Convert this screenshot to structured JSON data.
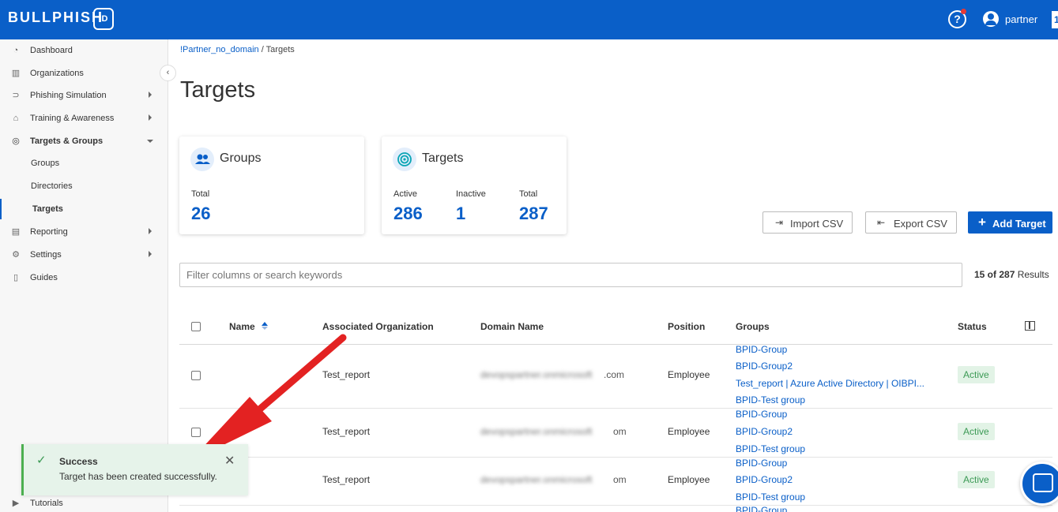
{
  "brand": {
    "name": "BULLPHISH",
    "badge": "ID"
  },
  "topbar": {
    "help_icon": "?",
    "user_name": "partner",
    "edge_badge": "1"
  },
  "sidebar": {
    "items": [
      {
        "label": "Dashboard",
        "icon": "dashboard-icon"
      },
      {
        "label": "Organizations",
        "icon": "building-icon"
      },
      {
        "label": "Phishing Simulation",
        "icon": "fish-hook-icon"
      },
      {
        "label": "Training & Awareness",
        "icon": "graduation-cap-icon"
      },
      {
        "label": "Targets & Groups",
        "icon": "target-icon"
      },
      {
        "label": "Groups"
      },
      {
        "label": "Directories"
      },
      {
        "label": "Targets"
      },
      {
        "label": "Reporting",
        "icon": "report-icon"
      },
      {
        "label": "Settings",
        "icon": "gear-icon"
      },
      {
        "label": "Guides",
        "icon": "book-icon"
      },
      {
        "label": "Tutorials",
        "icon": "play-icon"
      }
    ]
  },
  "breadcrumb": {
    "link": "!Partner_no_domain",
    "separator": " / ",
    "current": "Targets"
  },
  "page_title": "Targets",
  "groups_card": {
    "title": "Groups",
    "total_label": "Total",
    "total_value": "26"
  },
  "targets_card": {
    "title": "Targets",
    "active_label": "Active",
    "active_value": "286",
    "inactive_label": "Inactive",
    "inactive_value": "1",
    "total_label": "Total",
    "total_value": "287"
  },
  "actions": {
    "import": "Import CSV",
    "export": "Export CSV",
    "add": "Add Target"
  },
  "search": {
    "placeholder": "Filter columns or search keywords"
  },
  "results": {
    "count": "15 of 287",
    "suffix": " Results"
  },
  "table": {
    "headers": {
      "name": "Name",
      "org": "Associated Organization",
      "domain": "Domain Name",
      "position": "Position",
      "groups": "Groups",
      "status": "Status"
    },
    "rows": [
      {
        "org": "Test_report",
        "domain_hidden": "devopspartner.onmicrosoft",
        "domain_tail": ".com",
        "position": "Employee",
        "status": "Active",
        "groups": [
          "BPID-Group",
          "BPID-Group2",
          "Test_report | Azure Active Directory | OIBPI...",
          "BPID-Test group"
        ]
      },
      {
        "org": "Test_report",
        "domain_hidden": "devopspartner.onmicrosoft",
        "domain_tail": "om",
        "position": "Employee",
        "status": "Active",
        "groups": [
          "BPID-Group",
          "BPID-Group2",
          "BPID-Test group"
        ]
      },
      {
        "org": "Test_report",
        "domain_hidden": "devopspartner.onmicrosoft",
        "domain_tail": "om",
        "position": "Employee",
        "status": "Active",
        "groups": [
          "BPID-Group",
          "BPID-Group2",
          "BPID-Test group"
        ]
      },
      {
        "groups": [
          "BPID-Group"
        ]
      }
    ]
  },
  "toast": {
    "title": "Success",
    "message": "Target has been created successfully.",
    "close": "✕"
  },
  "colors": {
    "brand": "#0a5fc8",
    "success": "#3c9a55",
    "annotation_arrow": "#e32222"
  }
}
